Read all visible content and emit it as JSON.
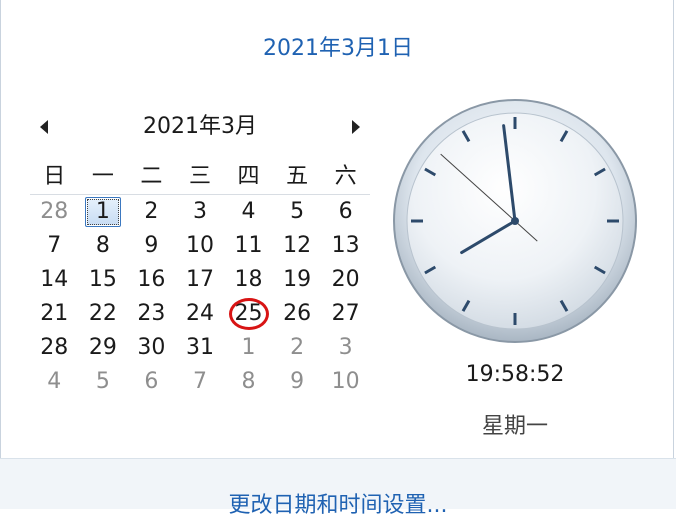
{
  "header": {
    "date_link": "2021年3月1日"
  },
  "calendar": {
    "month_title": "2021年3月",
    "weekdays": [
      "日",
      "一",
      "二",
      "三",
      "四",
      "五",
      "六"
    ],
    "weeks": [
      [
        "28",
        "1",
        "2",
        "3",
        "4",
        "5",
        "6"
      ],
      [
        "7",
        "8",
        "9",
        "10",
        "11",
        "12",
        "13"
      ],
      [
        "14",
        "15",
        "16",
        "17",
        "18",
        "19",
        "20"
      ],
      [
        "21",
        "22",
        "23",
        "24",
        "25",
        "26",
        "27"
      ],
      [
        "28",
        "29",
        "30",
        "31",
        "1",
        "2",
        "3"
      ],
      [
        "4",
        "5",
        "6",
        "7",
        "8",
        "9",
        "10"
      ]
    ],
    "selected_day": "1",
    "circled_day": "25"
  },
  "clock": {
    "time_text": "19:58:52",
    "weekday_text": "星期一",
    "hour": 19,
    "minute": 58,
    "second": 52
  },
  "footer": {
    "settings_link": "更改日期和时间设置..."
  },
  "colors": {
    "link": "#1f62b2",
    "circle": "#d81414",
    "hand": "#2d4a6b"
  }
}
